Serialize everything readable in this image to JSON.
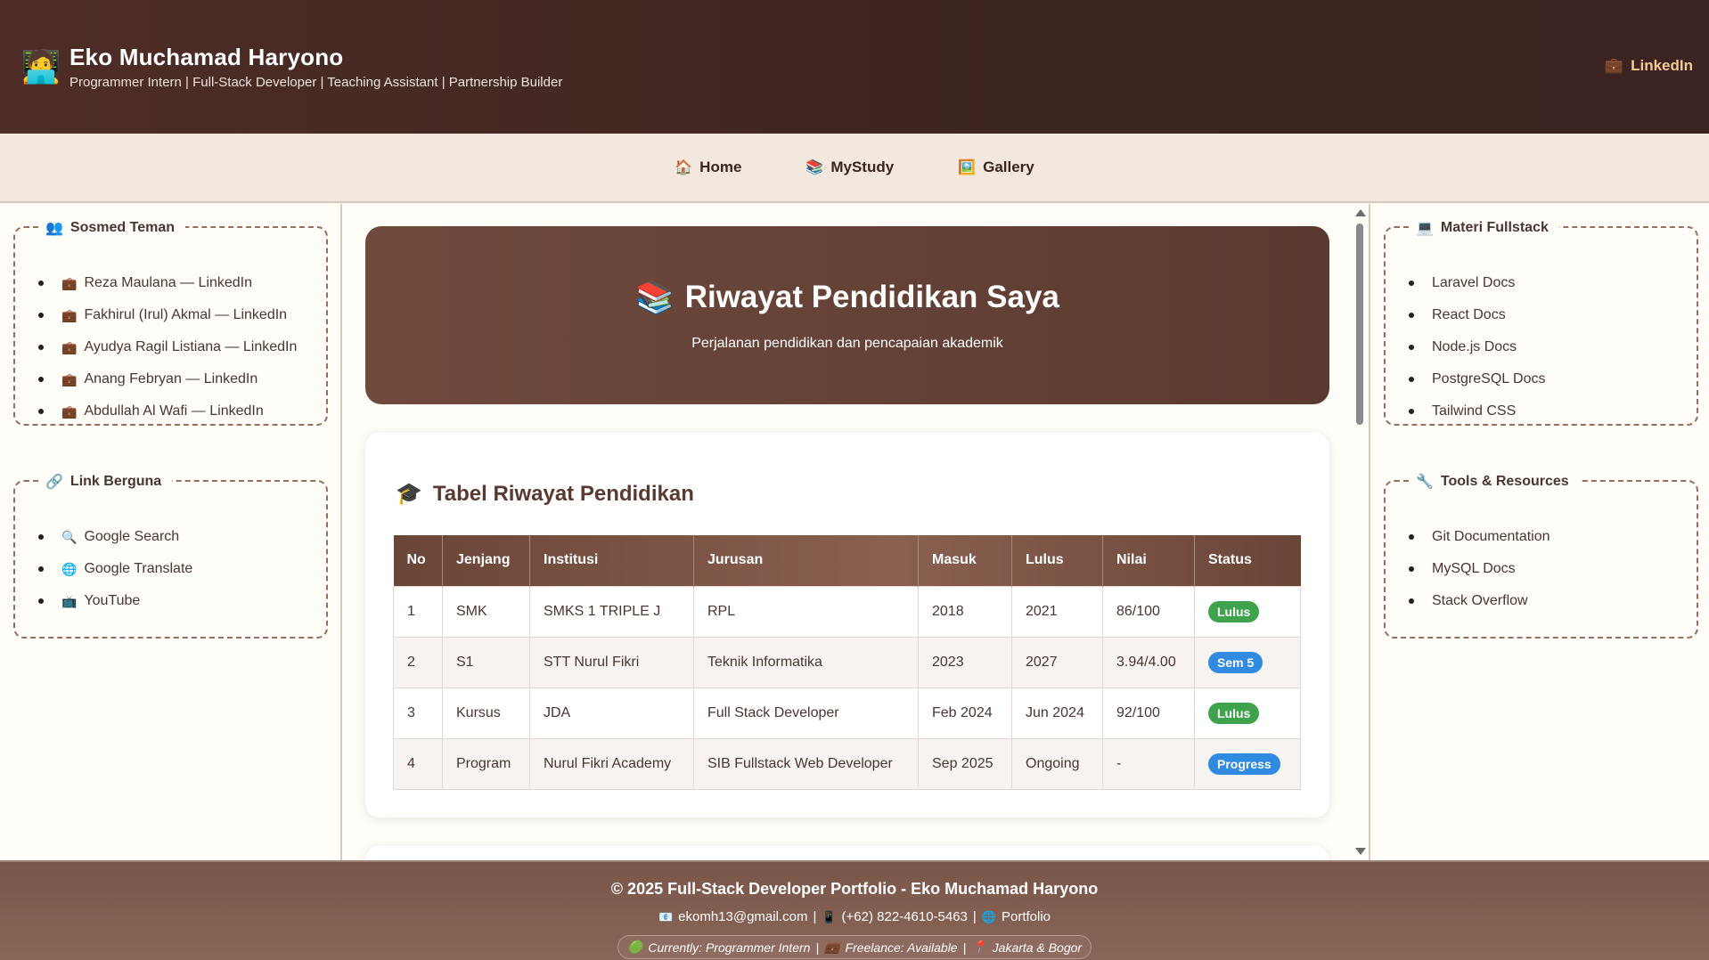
{
  "header": {
    "avatar_icon": "🧑‍💻",
    "name": "Eko Muchamad Haryono",
    "tagline": "Programmer Intern | Full-Stack Developer | Teaching Assistant | Partnership Builder",
    "link_icon": "💼",
    "link_label": "LinkedIn"
  },
  "nav": {
    "items": [
      {
        "icon": "🏠",
        "label": "Home"
      },
      {
        "icon": "📚",
        "label": "MyStudy"
      },
      {
        "icon": "🖼️",
        "label": "Gallery"
      }
    ]
  },
  "left_sidebar": {
    "friends": {
      "icon": "👥",
      "title": "Sosmed Teman",
      "items": [
        {
          "icon": "💼",
          "label": "Reza Maulana — LinkedIn"
        },
        {
          "icon": "💼",
          "label": "Fakhirul (Irul) Akmal — LinkedIn"
        },
        {
          "icon": "💼",
          "label": "Ayudya Ragil Listiana — LinkedIn"
        },
        {
          "icon": "💼",
          "label": "Anang Febryan — LinkedIn"
        },
        {
          "icon": "💼",
          "label": "Abdullah Al Wafi — LinkedIn"
        }
      ]
    },
    "links": {
      "icon": "🔗",
      "title": "Link Berguna",
      "items": [
        {
          "icon": "🔍",
          "label": "Google Search"
        },
        {
          "icon": "🌐",
          "label": "Google Translate"
        },
        {
          "icon": "📺",
          "label": "YouTube"
        }
      ]
    }
  },
  "right_sidebar": {
    "materials": {
      "icon": "💻",
      "title": "Materi Fullstack",
      "items": [
        "Laravel Docs",
        "React Docs",
        "Node.js Docs",
        "PostgreSQL Docs",
        "Tailwind CSS"
      ]
    },
    "tools": {
      "icon": "🔧",
      "title": "Tools & Resources",
      "items": [
        "Git Documentation",
        "MySQL Docs",
        "Stack Overflow"
      ]
    }
  },
  "hero": {
    "icon": "📚",
    "title": "Riwayat Pendidikan Saya",
    "subtitle": "Perjalanan pendidikan dan pencapaian akademik"
  },
  "education_table": {
    "icon": "🎓",
    "title": "Tabel Riwayat Pendidikan",
    "columns": [
      "No",
      "Jenjang",
      "Institusi",
      "Jurusan",
      "Masuk",
      "Lulus",
      "Nilai",
      "Status"
    ],
    "rows": [
      {
        "no": "1",
        "jenjang": "SMK",
        "institusi": "SMKS 1 TRIPLE J",
        "jurusan": "RPL",
        "masuk": "2018",
        "lulus": "2021",
        "nilai": "86/100",
        "status": "Lulus",
        "status_color": "#3fa34d"
      },
      {
        "no": "2",
        "jenjang": "S1",
        "institusi": "STT Nurul Fikri",
        "jurusan": "Teknik Informatika",
        "masuk": "2023",
        "lulus": "2027",
        "nilai": "3.94/4.00",
        "status": "Sem 5",
        "status_color": "#2f8ae0"
      },
      {
        "no": "3",
        "jenjang": "Kursus",
        "institusi": "JDA",
        "jurusan": "Full Stack Developer",
        "masuk": "Feb 2024",
        "lulus": "Jun 2024",
        "nilai": "92/100",
        "status": "Lulus",
        "status_color": "#3fa34d"
      },
      {
        "no": "4",
        "jenjang": "Program",
        "institusi": "Nurul Fikri Academy",
        "jurusan": "SIB Fullstack Web Developer",
        "masuk": "Sep 2025",
        "lulus": "Ongoing",
        "nilai": "-",
        "status": "Progress",
        "status_color": "#2f8ae0"
      }
    ]
  },
  "footer": {
    "title": "© 2025 Full-Stack Developer Portfolio - Eko Muchamad Haryono",
    "email_icon": "📧",
    "email": "ekomh13@gmail.com",
    "phone_icon": "📱",
    "phone": "(+62) 822-4610-5463",
    "portfolio_icon": "🌐",
    "portfolio": "Portfolio",
    "separator": "|",
    "status_items": [
      {
        "icon": "🟢",
        "label": "Currently: Programmer Intern"
      },
      {
        "icon": "💼",
        "label": "Freelance: Available"
      },
      {
        "icon": "📍",
        "label": "Jakarta & Bogor"
      }
    ]
  }
}
